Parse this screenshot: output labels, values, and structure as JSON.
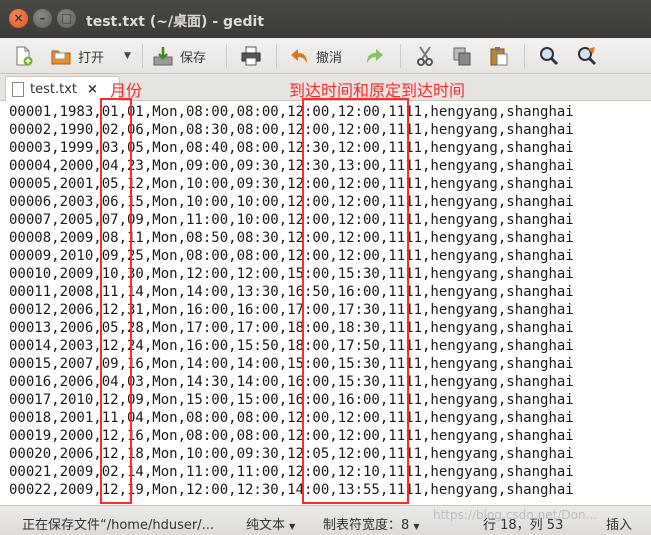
{
  "window": {
    "title": "test.txt (~/桌面) - gedit"
  },
  "toolbar": {
    "open_label": "打开",
    "save_label": "保存",
    "undo_label": "撤消"
  },
  "tab": {
    "name": "test.txt",
    "close": "×"
  },
  "annotations": {
    "month": "月份",
    "arrival": "到达时间和原定到达时间"
  },
  "lines": [
    "00001,1983,01,01,Mon,08:00,08:00,12:00,12:00,1111,hengyang,shanghai",
    "00002,1990,02,06,Mon,08:30,08:00,12:00,12:00,1111,hengyang,shanghai",
    "00003,1999,03,05,Mon,08:40,08:00,12:30,12:00,1111,hengyang,shanghai",
    "00004,2000,04,23,Mon,09:00,09:30,12:30,13:00,1111,hengyang,shanghai",
    "00005,2001,05,12,Mon,10:00,09:30,12:00,12:00,1111,hengyang,shanghai",
    "00006,2003,06,15,Mon,10:00,10:00,12:00,12:00,1111,hengyang,shanghai",
    "00007,2005,07,09,Mon,11:00,10:00,12:00,12:00,1111,hengyang,shanghai",
    "00008,2009,08,11,Mon,08:50,08:30,12:00,12:00,1111,hengyang,shanghai",
    "00009,2010,09,25,Mon,08:00,08:00,12:00,12:00,1111,hengyang,shanghai",
    "00010,2009,10,30,Mon,12:00,12:00,15:00,15:30,1111,hengyang,shanghai",
    "00011,2008,11,14,Mon,14:00,13:30,16:50,16:00,1111,hengyang,shanghai",
    "00012,2006,12,31,Mon,16:00,16:00,17:00,17:30,1111,hengyang,shanghai",
    "00013,2006,05,28,Mon,17:00,17:00,18:00,18:30,1111,hengyang,shanghai",
    "00014,2003,12,24,Mon,16:00,15:50,18:00,17:50,1111,hengyang,shanghai",
    "00015,2007,09,16,Mon,14:00,14:00,15:00,15:30,1111,hengyang,shanghai",
    "00016,2006,04,03,Mon,14:30,14:00,16:00,15:30,1111,hengyang,shanghai",
    "00017,2010,12,09,Mon,15:00,15:00,16:00,16:00,1111,hengyang,shanghai",
    "00018,2001,11,04,Mon,08:00,08:00,12:00,12:00,1111,hengyang,shanghai",
    "00019,2000,12,16,Mon,08:00,08:00,12:00,12:00,1111,hengyang,shanghai",
    "00020,2006,12,18,Mon,10:00,09:30,12:05,12:00,1111,hengyang,shanghai",
    "00021,2009,02,14,Mon,11:00,11:00,12:00,12:10,1111,hengyang,shanghai",
    "00022,2009,12,19,Mon,12:00,12:30,14:00,13:55,1111,hengyang,shanghai"
  ],
  "statusbar": {
    "saving": "正在保存文件“/home/hduser/...",
    "syntax": "纯文本",
    "tabwidth": "制表符宽度：8",
    "position": "行 18，列 53",
    "mode": "插入",
    "watermark": "https://blog.csdn.net/Don..."
  },
  "colors": {
    "annotation": "#ff2a2a",
    "titlebar": "#3c3b37"
  }
}
